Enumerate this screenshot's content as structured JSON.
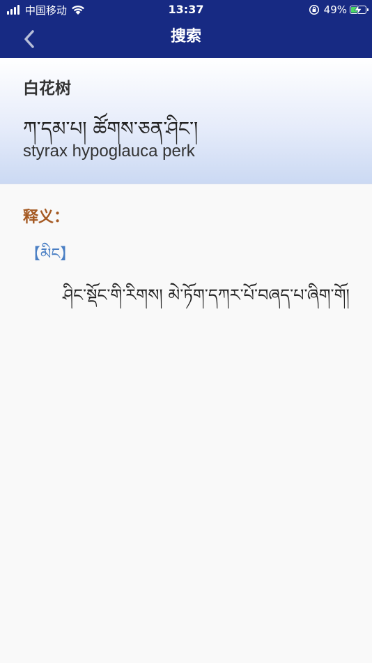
{
  "status_bar": {
    "carrier": "中国移动",
    "time": "13:37",
    "battery_percent": "49%",
    "battery_level": 0.49,
    "battery_color": "#4cd964"
  },
  "nav": {
    "title": "搜索",
    "back_icon": "chevron-left-icon"
  },
  "word": {
    "chinese": "白花树",
    "tibetan": "ཀ་དམ་པ། ཚོགས་ཅན་ཤིང་།",
    "latin": "styrax hypoglauca perk"
  },
  "definition": {
    "label": "释义：",
    "pos": "【མིང】",
    "text": "ཤིང་སྡོང་གི་རིགས། མེ་ཏོག་དཀར་པོ་བཞད་པ་ཞིག་གོ།"
  },
  "colors": {
    "header_bg": "#172a83",
    "label_color": "#a55a23",
    "pos_color": "#4a7fc4"
  }
}
